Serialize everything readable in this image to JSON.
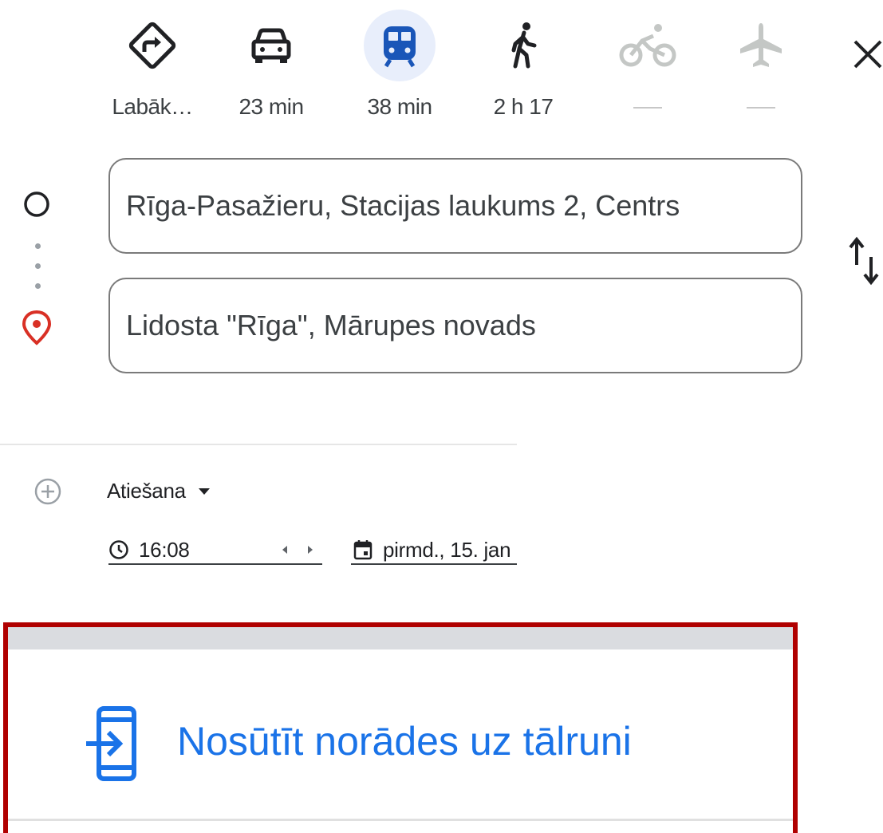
{
  "travel_modes": [
    {
      "id": "best",
      "icon": "directions-diamond-icon",
      "label": "Labāk…",
      "state": "normal"
    },
    {
      "id": "driving",
      "icon": "car-icon",
      "label": "23 min",
      "state": "normal"
    },
    {
      "id": "transit",
      "icon": "train-icon",
      "label": "38 min",
      "state": "selected"
    },
    {
      "id": "walking",
      "icon": "walking-icon",
      "label": "2 h 17",
      "state": "normal"
    },
    {
      "id": "cycling",
      "icon": "bicycle-icon",
      "label": "—",
      "state": "disabled"
    },
    {
      "id": "flights",
      "icon": "airplane-icon",
      "label": "—",
      "state": "disabled"
    }
  ],
  "close_icon": "close-icon",
  "origin": {
    "value": "Rīga-Pasažieru, Stacijas laukums 2, Centrs"
  },
  "destination": {
    "value": "Lidosta \"Rīga\", Mārupes novads"
  },
  "swap_icon": "swap-vertical-icon",
  "add_stop_icon": "add-circle-icon",
  "departure": {
    "option": "Atiešana",
    "time": "16:08",
    "date": "pirmd., 15. jan"
  },
  "send_to_phone": {
    "label": "Nosūtīt norādes uz tālruni",
    "icon": "send-to-phone-icon"
  },
  "colors": {
    "accent": "#1a73e8",
    "transit_selected": "#1a56b8",
    "selected_bg": "#e8eefb",
    "destination_pin": "#d93025",
    "highlight_border": "#b00000"
  }
}
